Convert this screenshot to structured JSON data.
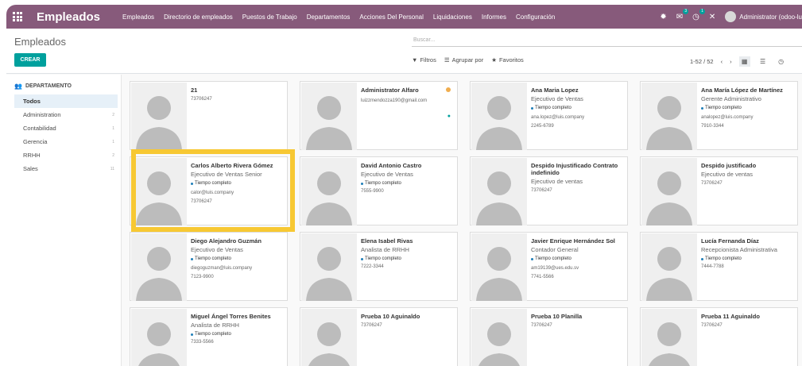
{
  "navbar": {
    "brand": "Empleados",
    "menu": [
      "Empleados",
      "Directorio de empleados",
      "Puestos de Trabajo",
      "Departamentos",
      "Acciones Del Personal",
      "Liquidaciones",
      "Informes",
      "Configuración"
    ],
    "chat_badge": "3",
    "activity_badge": "1",
    "user_name": "Administrator (odoo-lu",
    "bg_color": "#875a7b"
  },
  "control_panel": {
    "title": "Empleados",
    "search_placeholder": "Buscar...",
    "create_label": "CREAR",
    "filters_label": "Filtros",
    "groupby_label": "Agrupar por",
    "favorites_label": "Favoritos",
    "pager": "1-52 / 52"
  },
  "sidebar": {
    "header": "DEPARTAMENTO",
    "items": [
      {
        "label": "Todos",
        "count": ""
      },
      {
        "label": "Administration",
        "count": "2"
      },
      {
        "label": "Contabilidad",
        "count": "1"
      },
      {
        "label": "Gerencia",
        "count": "1"
      },
      {
        "label": "RRHH",
        "count": "2"
      },
      {
        "label": "Sales",
        "count": "11"
      }
    ]
  },
  "employees": [
    {
      "name": "21",
      "job": "",
      "tag": "",
      "email": "",
      "phone": "73706247"
    },
    {
      "name": "Administrator Alfaro",
      "job": "",
      "tag": "",
      "email": "luizzmendozza190@gmail.com",
      "phone": ""
    },
    {
      "name": "Ana Maria Lopez",
      "job": "Ejecutivo de Ventas",
      "tag": "Tiempo completo",
      "email": "ana.lopez@luis.company",
      "phone": "2245-6789"
    },
    {
      "name": "Ana María López de Martínez",
      "job": "Gerente Administrativo",
      "tag": "Tiempo completo",
      "email": "analopez@luis.company",
      "phone": "7910-3344"
    },
    {
      "name": "Carlos Alberto Rivera Gómez",
      "job": "Ejecutivo de Ventas Senior",
      "tag": "Tiempo completo",
      "email": "calor@luis.company",
      "phone": "73706247"
    },
    {
      "name": "David Antonio Castro",
      "job": "Ejecutivo de Ventas",
      "tag": "Tiempo completo",
      "email": "",
      "phone": "7555-9900"
    },
    {
      "name": "Despido Injustificado Contrato indefinido",
      "job": "Ejecutivo de ventas",
      "tag": "",
      "email": "",
      "phone": "73706247"
    },
    {
      "name": "Despido justificado",
      "job": "Ejecutivo de ventas",
      "tag": "",
      "email": "",
      "phone": "73706247"
    },
    {
      "name": "Diego Alejandro Guzmán",
      "job": "Ejecutivo de Ventas",
      "tag": "Tiempo completo",
      "email": "diegoguzman@luis.company",
      "phone": "7123-9900"
    },
    {
      "name": "Elena Isabel Rivas",
      "job": "Analista de RRHH",
      "tag": "Tiempo completo",
      "email": "",
      "phone": "7222-3344"
    },
    {
      "name": "Javier Enrique Hernández Sol",
      "job": "Contador General",
      "tag": "Tiempo completo",
      "email": "am19139@ues.edu.sv",
      "phone": "7741-5566"
    },
    {
      "name": "Lucía Fernanda Díaz",
      "job": "Recepcionista Administrativa",
      "tag": "Tiempo completo",
      "email": "",
      "phone": "7444-7788"
    },
    {
      "name": "Miguel Ángel Torres Benites",
      "job": "Analista de RRHH",
      "tag": "Tiempo completo",
      "email": "",
      "phone": "7333-5566"
    },
    {
      "name": "Prueba 10 Aguinaldo",
      "job": "",
      "tag": "",
      "email": "",
      "phone": "73706247"
    },
    {
      "name": "Prueba 10 Planilla",
      "job": "",
      "tag": "",
      "email": "",
      "phone": "73706247"
    },
    {
      "name": "Prueba 11 Aguinaldo",
      "job": "",
      "tag": "",
      "email": "",
      "phone": "73706247"
    }
  ],
  "colors": {
    "accent": "#00a09d",
    "highlight": "#f7c833",
    "status_dot": "#f0ad4e"
  }
}
